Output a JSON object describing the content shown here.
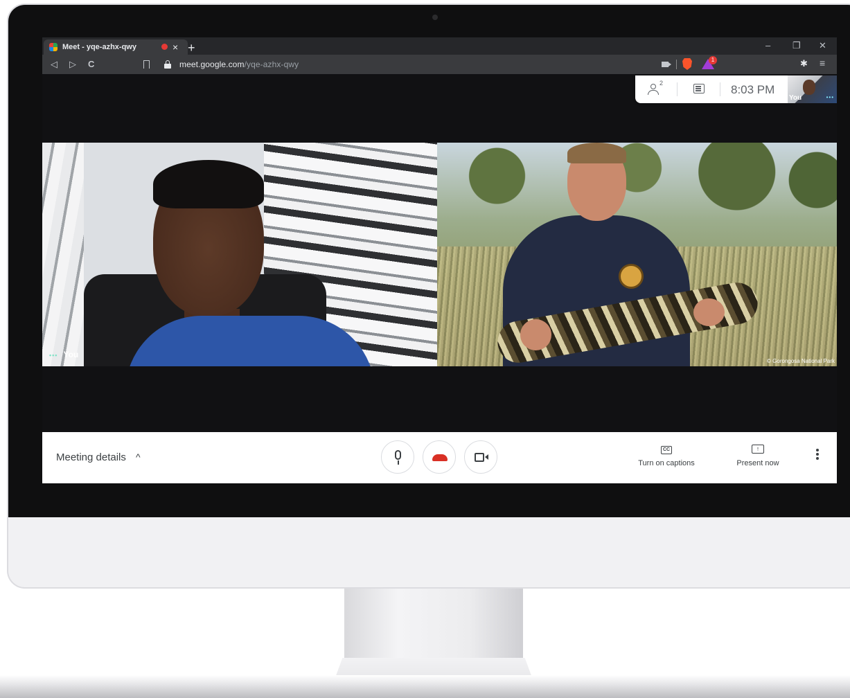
{
  "browser": {
    "tab_title": "Meet - yqe-azhx-qwy",
    "tab_close": "×",
    "new_tab": "+",
    "window_controls": {
      "minimize": "–",
      "restore": "❐",
      "close": "✕"
    },
    "nav": {
      "back": "◁",
      "forward": "▷",
      "reload": "C"
    },
    "url_domain": "meet.google.com",
    "url_path": "/yqe-azhx-qwy",
    "rewards_badge": "1",
    "extensions_icon": "puzzle-icon",
    "menu_icon": "≡"
  },
  "meet": {
    "people_count": "2",
    "time": "8:03 PM",
    "self_view_label": "You",
    "self_view_dots": "•••",
    "tiles": {
      "self_label": "You",
      "self_dots": "•••",
      "remote_credit": "© Gorongosa National Park"
    },
    "bottom_bar": {
      "meeting_details": "Meeting details",
      "chevron": "^",
      "captions_label": "Turn on captions",
      "captions_icon_text": "CC",
      "present_label": "Present now",
      "present_icon_text": "↑"
    }
  },
  "colors": {
    "hangup": "#d93025",
    "brave": "#fb542b",
    "rewards": "#a23cd6"
  }
}
